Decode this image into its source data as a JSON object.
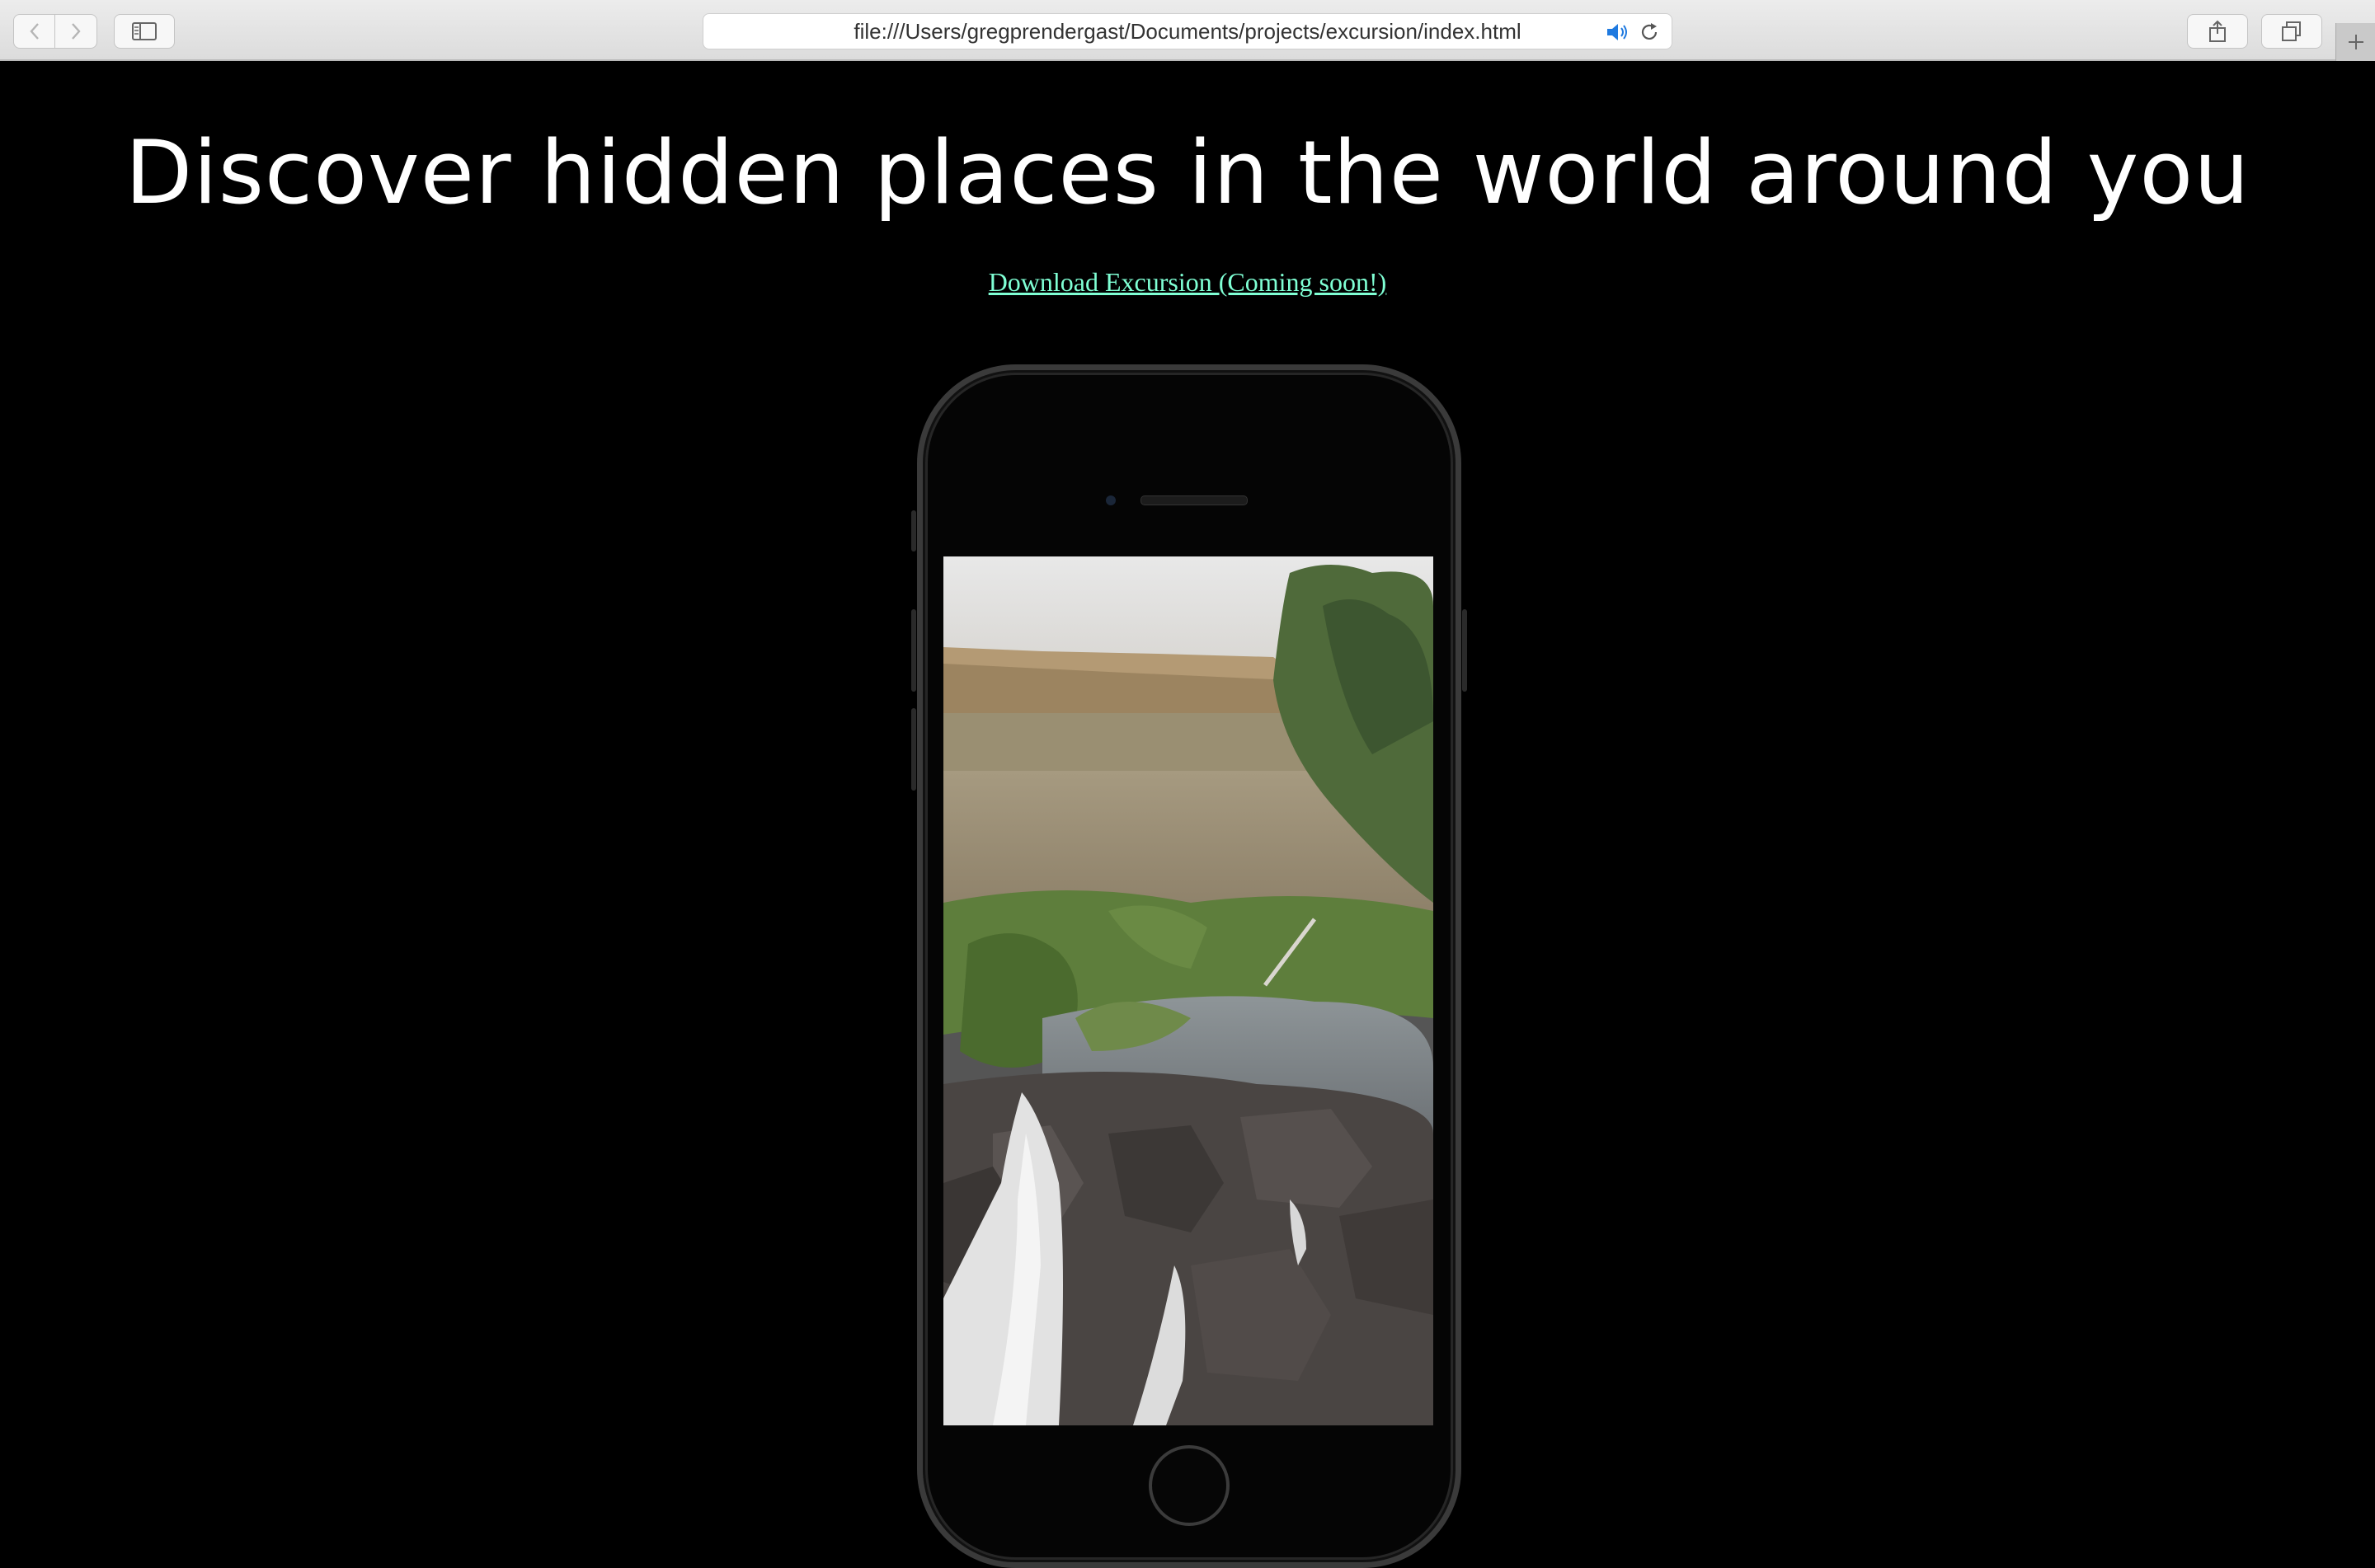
{
  "browser": {
    "url": "file:///Users/gregprendergast/Documents/projects/excursion/index.html",
    "back_icon": "chevron-left-icon",
    "forward_icon": "chevron-right-icon",
    "sidebar_icon": "sidebar-icon",
    "speaker_icon": "speaker-icon",
    "reload_icon": "reload-icon",
    "share_icon": "share-icon",
    "tabs_icon": "tabs-icon",
    "new_tab_icon": "plus-icon"
  },
  "page": {
    "headline": "Discover hidden places in the world around you",
    "download_link": "Download Excursion (Coming soon!)",
    "link_color": "#7fffd4",
    "background": "#000000"
  }
}
